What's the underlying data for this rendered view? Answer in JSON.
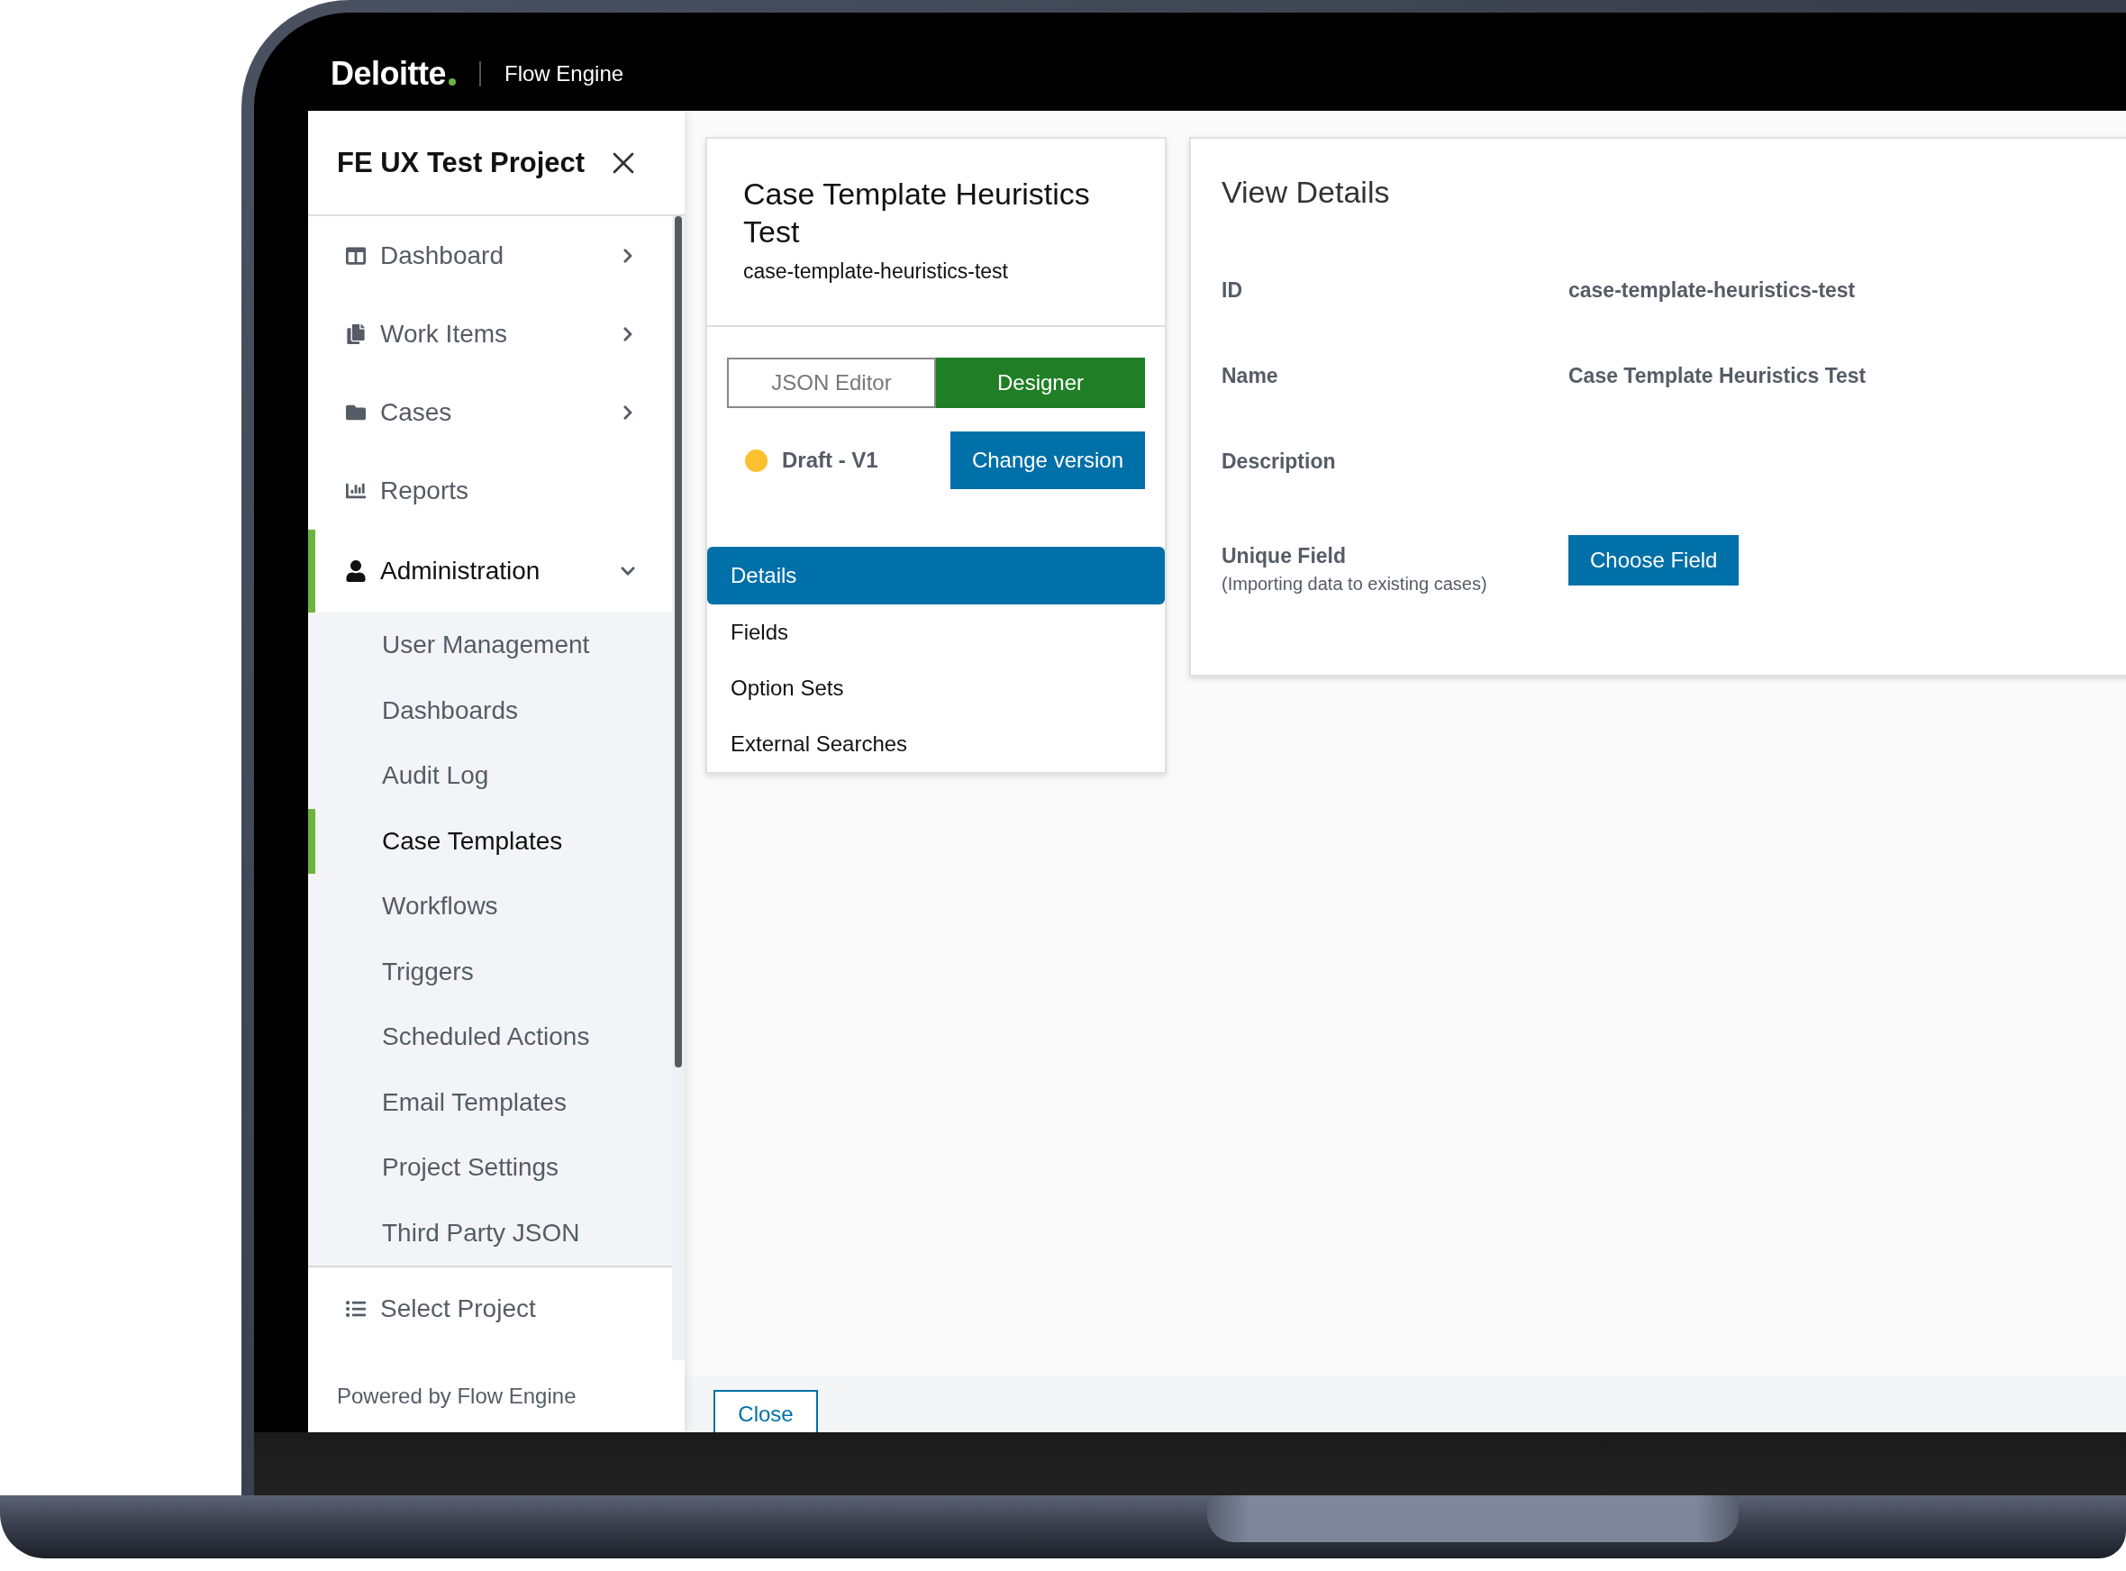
{
  "header": {
    "logo": "Deloitte",
    "product": "Flow Engine"
  },
  "sidebar": {
    "project": "FE UX Test Project",
    "nav": [
      {
        "label": "Dashboard",
        "expandable": true,
        "expanded": false,
        "selected": false
      },
      {
        "label": "Work Items",
        "expandable": true,
        "expanded": false,
        "selected": false
      },
      {
        "label": "Cases",
        "expandable": true,
        "expanded": false,
        "selected": false
      },
      {
        "label": "Reports",
        "expandable": false,
        "selected": false
      },
      {
        "label": "Administration",
        "expandable": true,
        "expanded": true,
        "selected": true,
        "children": [
          {
            "label": "User Management",
            "selected": false
          },
          {
            "label": "Dashboards",
            "selected": false
          },
          {
            "label": "Audit Log",
            "selected": false
          },
          {
            "label": "Case Templates",
            "selected": true
          },
          {
            "label": "Workflows",
            "selected": false
          },
          {
            "label": "Triggers",
            "selected": false
          },
          {
            "label": "Scheduled Actions",
            "selected": false
          },
          {
            "label": "Email Templates",
            "selected": false
          },
          {
            "label": "Project Settings",
            "selected": false
          },
          {
            "label": "Third Party JSON",
            "selected": false
          }
        ]
      }
    ],
    "select_project": "Select Project",
    "footer": "Powered by Flow Engine"
  },
  "template_card": {
    "title": "Case Template Heuristics Test",
    "slug": "case-template-heuristics-test",
    "modes": [
      {
        "label": "JSON Editor",
        "selected": false
      },
      {
        "label": "Designer",
        "selected": true
      }
    ],
    "status": {
      "label": "Draft - V1",
      "color": "#fbc02d"
    },
    "change_version": "Change version",
    "sections": [
      {
        "label": "Details",
        "selected": true
      },
      {
        "label": "Fields",
        "selected": false
      },
      {
        "label": "Option Sets",
        "selected": false
      },
      {
        "label": "External Searches",
        "selected": false
      }
    ]
  },
  "details": {
    "title": "View Details",
    "rows": [
      {
        "kind": "text",
        "label": "ID",
        "value": "case-template-heuristics-test"
      },
      {
        "kind": "text",
        "label": "Name",
        "value": "Case Template Heuristics Test"
      },
      {
        "kind": "text",
        "label": "Description"
      },
      {
        "kind": "button",
        "label": "Unique Field",
        "hint": "(Importing data to existing cases)",
        "button": "Choose Field"
      }
    ]
  },
  "footer_button": "Close"
}
